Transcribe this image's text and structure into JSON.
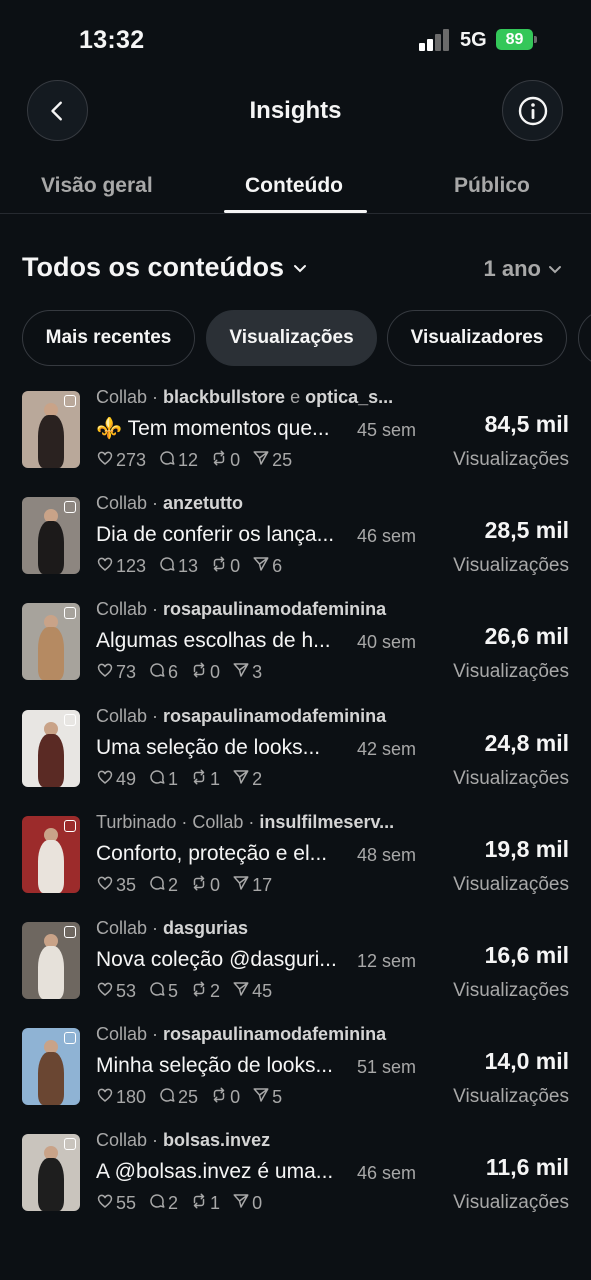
{
  "status_bar": {
    "time": "13:32",
    "network": "5G",
    "battery": "89"
  },
  "header": {
    "title": "Insights",
    "back_icon": "chevron-left-icon",
    "info_icon": "info-icon"
  },
  "tabs": [
    {
      "label": "Visão geral"
    },
    {
      "label": "Conteúdo",
      "active": true
    },
    {
      "label": "Público"
    }
  ],
  "section": {
    "title": "Todos os conteúdos",
    "period": "1 ano"
  },
  "chips": [
    {
      "label": "Mais recentes"
    },
    {
      "label": "Visualizações",
      "active": true
    },
    {
      "label": "Visualizadores"
    }
  ],
  "posts": [
    {
      "type": "Collab",
      "accounts": "blackbullstore",
      "join": "e",
      "accounts2": "optica_s...",
      "caption": "⚜️ Tem momentos que...",
      "age": "45 sem",
      "likes": "273",
      "comments": "12",
      "reposts": "0",
      "shares": "25",
      "value": "84,5 mil",
      "value_label": "Visualizações",
      "thumb_bg": "#b9a89a",
      "fig": "#2a2220"
    },
    {
      "type": "Collab",
      "accounts": "anzetutto",
      "caption": "Dia de conferir os lança...",
      "age": "46 sem",
      "likes": "123",
      "comments": "13",
      "reposts": "0",
      "shares": "6",
      "value": "28,5 mil",
      "value_label": "Visualizações",
      "thumb_bg": "#8d8680",
      "fig": "#1c1a1a"
    },
    {
      "type": "Collab",
      "accounts": "rosapaulinamodafeminina",
      "caption": "Algumas escolhas de h...",
      "age": "40 sem",
      "likes": "73",
      "comments": "6",
      "reposts": "0",
      "shares": "3",
      "value": "26,6 mil",
      "value_label": "Visualizações",
      "thumb_bg": "#a7a39c",
      "fig": "#b58a62"
    },
    {
      "type": "Collab",
      "accounts": "rosapaulinamodafeminina",
      "caption": "Uma seleção de looks...",
      "age": "42 sem",
      "likes": "49",
      "comments": "1",
      "reposts": "1",
      "shares": "2",
      "value": "24,8 mil",
      "value_label": "Visualizações",
      "thumb_bg": "#e8e6e3",
      "fig": "#5a2a24"
    },
    {
      "type": "Turbinado · Collab ·",
      "accounts": "insulfilmeserv...",
      "caption": "Conforto, proteção e el...",
      "age": "48 sem",
      "likes": "35",
      "comments": "2",
      "reposts": "0",
      "shares": "17",
      "value": "19,8 mil",
      "value_label": "Visualizações",
      "thumb_bg": "#9c2b2b",
      "fig": "#e9e3dc"
    },
    {
      "type": "Collab",
      "accounts": "dasgurias",
      "caption": "Nova coleção @dasguri...",
      "age": "12 sem",
      "likes": "53",
      "comments": "5",
      "reposts": "2",
      "shares": "45",
      "value": "16,6 mil",
      "value_label": "Visualizações",
      "thumb_bg": "#6e6760",
      "fig": "#e6e1da"
    },
    {
      "type": "Collab",
      "accounts": "rosapaulinamodafeminina",
      "caption": "Minha seleção de looks...",
      "age": "51 sem",
      "likes": "180",
      "comments": "25",
      "reposts": "0",
      "shares": "5",
      "value": "14,0 mil",
      "value_label": "Visualizações",
      "thumb_bg": "#8fb3d4",
      "fig": "#6a4632"
    },
    {
      "type": "Collab",
      "accounts": "bolsas.invez",
      "caption": "A @bolsas.invez é uma...",
      "age": "46 sem",
      "likes": "55",
      "comments": "2",
      "reposts": "1",
      "shares": "0",
      "value": "11,6 mil",
      "value_label": "Visualizações",
      "thumb_bg": "#c9c4bd",
      "fig": "#1e1e1e"
    }
  ],
  "colors": {
    "background": "#0c1014",
    "text_primary": "#f5f5f5",
    "text_secondary": "#a8a8a8",
    "battery": "#34c759"
  }
}
